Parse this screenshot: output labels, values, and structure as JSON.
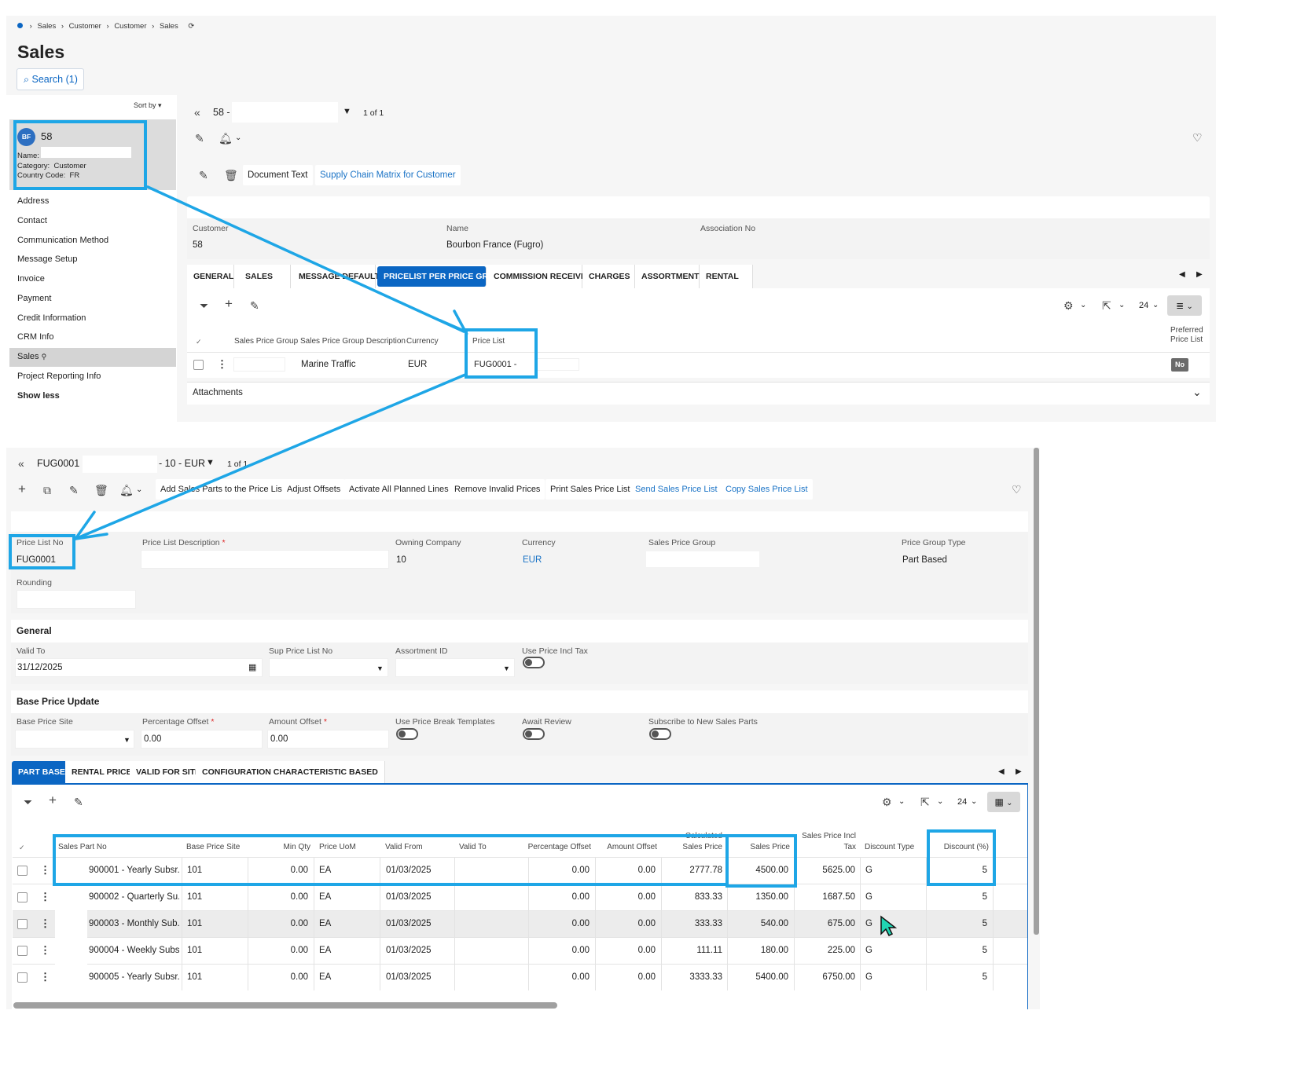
{
  "top": {
    "breadcrumb": [
      "Sales",
      "Customer",
      "Customer",
      "Sales"
    ],
    "page_title": "Sales",
    "search_label": "Search (1)",
    "sort_by": "Sort by",
    "record_nav": "58 -",
    "record_count": "1 of 1",
    "card": {
      "avatar": "BF",
      "id": "58",
      "name_label": "Name:",
      "category": "Category:  Customer",
      "country": "Country Code:  FR"
    },
    "nav_items": [
      "Address",
      "Contact",
      "Communication Method",
      "Message Setup",
      "Invoice",
      "Payment",
      "Credit Information",
      "CRM Info",
      "Sales",
      "Project Reporting Info",
      "Show less"
    ],
    "toolbar": {
      "document_text": "Document Text",
      "supply_chain": "Supply Chain Matrix for Customer"
    },
    "header": {
      "customer_label": "Customer",
      "customer_value": "58",
      "name_label": "Name",
      "name_value": "Bourbon France (Fugro)",
      "association_label": "Association No"
    },
    "tabs": [
      "GENERAL",
      "SALES",
      "MESSAGE DEFAULTS",
      "PRICELIST PER PRICE GROUP",
      "COMMISSION RECEIVER",
      "CHARGES",
      "ASSORTMENTS",
      "RENTAL"
    ],
    "grid_count": "24",
    "columns": [
      "Sales Price Group",
      "Sales Price Group Description",
      "Currency",
      "Price List",
      "Preferred Price List"
    ],
    "row": {
      "description": "Marine Traffic",
      "currency": "EUR",
      "price_list": "FUG0001 -",
      "preferred": "No"
    },
    "attachments": "Attachments"
  },
  "bottom": {
    "record_nav_left": "FUG0001 -",
    "record_nav_right": "- 10 - EUR",
    "record_count": "1 of 1",
    "toolbar": [
      "Add Sales Parts to the Price List",
      "Adjust Offsets",
      "Activate All Planned Lines",
      "Remove Invalid Prices",
      "Print Sales Price List",
      "Send Sales Price List",
      "Copy Sales Price List"
    ],
    "header": {
      "price_list_no_label": "Price List No",
      "price_list_no": "FUG0001",
      "description_label": "Price List Description",
      "owning_company_label": "Owning Company",
      "owning_company": "10",
      "currency_label": "Currency",
      "currency": "EUR",
      "sales_price_group_label": "Sales Price Group",
      "price_group_type_label": "Price Group Type",
      "price_group_type": "Part Based",
      "rounding_label": "Rounding"
    },
    "general": {
      "title": "General",
      "valid_to_label": "Valid To",
      "valid_to": "31/12/2025",
      "sup_price_list_label": "Sup Price List No",
      "assortment_label": "Assortment ID",
      "use_price_incl_tax_label": "Use Price Incl Tax"
    },
    "base_price": {
      "title": "Base Price Update",
      "base_price_site_label": "Base Price Site",
      "percentage_offset_label": "Percentage Offset",
      "percentage_offset": "0.00",
      "amount_offset_label": "Amount Offset",
      "amount_offset": "0.00",
      "use_price_break_label": "Use Price Break Templates",
      "await_review_label": "Await Review",
      "subscribe_label": "Subscribe to New Sales Parts"
    },
    "tabs": [
      "PART BASED",
      "RENTAL PRICES",
      "VALID FOR SITE",
      "CONFIGURATION CHARACTERISTIC BASED"
    ],
    "grid_count": "24",
    "columns": [
      "Sales Part No",
      "Base Price Site",
      "Min Qty",
      "Price UoM",
      "Valid From",
      "Valid To",
      "Percentage Offset",
      "Amount Offset",
      "Calculated Sales Price",
      "Sales Price",
      "Sales Price Incl Tax",
      "Discount Type",
      "Discount (%)"
    ],
    "rows": [
      {
        "part": "900001 - Yearly Subsr...",
        "site": "101",
        "min_qty": "0.00",
        "uom": "EA",
        "valid_from": "01/03/2025",
        "pct": "0.00",
        "amt": "0.00",
        "calc": "2777.78",
        "price": "4500.00",
        "incl": "5625.00",
        "dtype": "G",
        "disc": "5"
      },
      {
        "part": "900002 - Quarterly Su...",
        "site": "101",
        "min_qty": "0.00",
        "uom": "EA",
        "valid_from": "01/03/2025",
        "pct": "0.00",
        "amt": "0.00",
        "calc": "833.33",
        "price": "1350.00",
        "incl": "1687.50",
        "dtype": "G",
        "disc": "5"
      },
      {
        "part": "900003 - Monthly Sub...",
        "site": "101",
        "min_qty": "0.00",
        "uom": "EA",
        "valid_from": "01/03/2025",
        "pct": "0.00",
        "amt": "0.00",
        "calc": "333.33",
        "price": "540.00",
        "incl": "675.00",
        "dtype": "G",
        "disc": "5"
      },
      {
        "part": "900004 - Weekly Subs...",
        "site": "101",
        "min_qty": "0.00",
        "uom": "EA",
        "valid_from": "01/03/2025",
        "pct": "0.00",
        "amt": "0.00",
        "calc": "111.11",
        "price": "180.00",
        "incl": "225.00",
        "dtype": "G",
        "disc": "5"
      },
      {
        "part": "900005 - Yearly Subsr...",
        "site": "101",
        "min_qty": "0.00",
        "uom": "EA",
        "valid_from": "01/03/2025",
        "pct": "0.00",
        "amt": "0.00",
        "calc": "3333.33",
        "price": "5400.00",
        "incl": "6750.00",
        "dtype": "G",
        "disc": "5"
      }
    ]
  }
}
